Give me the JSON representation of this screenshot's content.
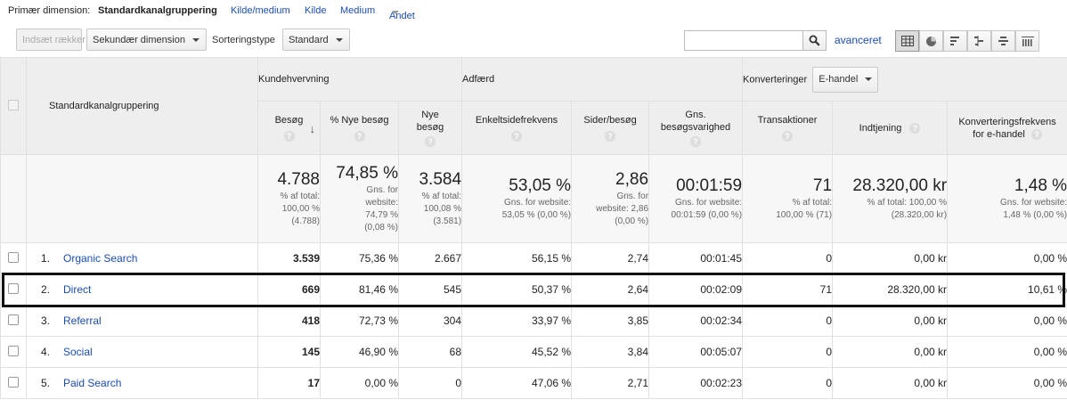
{
  "dimension_bar": {
    "label": "Primær dimension:",
    "active": "Standardkanalgruppering",
    "links": [
      "Kilde/medium",
      "Kilde",
      "Medium",
      "Andet"
    ]
  },
  "toolbar": {
    "insert_rows": "Indsæt rækker",
    "secondary_dimension": "Sekundær dimension",
    "sort_type_label": "Sorteringstype",
    "sort_type_value": "Standard",
    "search_value": "",
    "advanced_link": "avanceret",
    "view_icons": [
      "table-view-icon",
      "pie-view-icon",
      "performance-view-icon",
      "comparison-view-icon",
      "term-cloud-view-icon",
      "pivot-view-icon"
    ]
  },
  "table": {
    "dimension_header": "Standardkanalgruppering",
    "groups": {
      "acquisition": "Kundehvervning",
      "behavior": "Adfærd",
      "conversions": "Konverteringer",
      "conversion_select": "E-handel"
    },
    "metric_headers": {
      "sessions": "Besøg",
      "new_sessions_pct": "% Nye besøg",
      "new_sessions": [
        "Nye",
        "besøg"
      ],
      "bounce_rate": "Enkeltsidefrekvens",
      "pages_per_session": "Sider/besøg",
      "avg_duration": [
        "Gns.",
        "besøgsvarighed"
      ],
      "transactions": "Transaktioner",
      "revenue": "Indtjening",
      "conv_rate": [
        "Konverteringsfrekvens",
        "for e-handel"
      ]
    },
    "help_glyph": "?",
    "sort_arrow": "↓",
    "totals": [
      {
        "value": "4.788",
        "sub": [
          "% af total:",
          "100,00 %",
          "(4.788)"
        ]
      },
      {
        "value": "74,85 %",
        "sub": [
          "Gns. for",
          "website:",
          "74,79 %",
          "(0,08 %)"
        ]
      },
      {
        "value": "3.584",
        "sub": [
          "% af total:",
          "100,08 %",
          "(3.581)"
        ]
      },
      {
        "value": "53,05 %",
        "sub": [
          "Gns. for website:",
          "53,05 % (0,00 %)"
        ]
      },
      {
        "value": "2,86",
        "sub": [
          "Gns. for",
          "website: 2,86",
          "(0,00 %)"
        ]
      },
      {
        "value": "00:01:59",
        "sub": [
          "Gns. for website:",
          "00:01:59 (0,00 %)"
        ]
      },
      {
        "value": "71",
        "sub": [
          "% af total:",
          "100,00 % (71)"
        ]
      },
      {
        "value": "28.320,00 kr",
        "sub": [
          "% af total: 100,00 %",
          "(28.320,00 kr)"
        ]
      },
      {
        "value": "1,48 %",
        "sub": [
          "Gns. for website:",
          "1,48 % (0,00 %)"
        ]
      }
    ],
    "rows": [
      {
        "index": "1.",
        "name": "Organic Search",
        "cells": [
          "3.539",
          "75,36 %",
          "2.667",
          "56,15 %",
          "2,74",
          "00:01:45",
          "0",
          "0,00 kr",
          "0,00 %"
        ]
      },
      {
        "index": "2.",
        "name": "Direct",
        "cells": [
          "669",
          "81,46 %",
          "545",
          "50,37 %",
          "2,64",
          "00:02:09",
          "71",
          "28.320,00 kr",
          "10,61 %"
        ]
      },
      {
        "index": "3.",
        "name": "Referral",
        "cells": [
          "418",
          "72,73 %",
          "304",
          "33,97 %",
          "3,85",
          "00:02:34",
          "0",
          "0,00 kr",
          "0,00 %"
        ]
      },
      {
        "index": "4.",
        "name": "Social",
        "cells": [
          "145",
          "46,90 %",
          "68",
          "45,52 %",
          "3,84",
          "00:05:07",
          "0",
          "0,00 kr",
          "0,00 %"
        ]
      },
      {
        "index": "5.",
        "name": "Paid Search",
        "cells": [
          "17",
          "0,00 %",
          "0",
          "47,06 %",
          "2,71",
          "00:02:23",
          "0",
          "0,00 kr",
          "0,00 %"
        ]
      }
    ]
  }
}
